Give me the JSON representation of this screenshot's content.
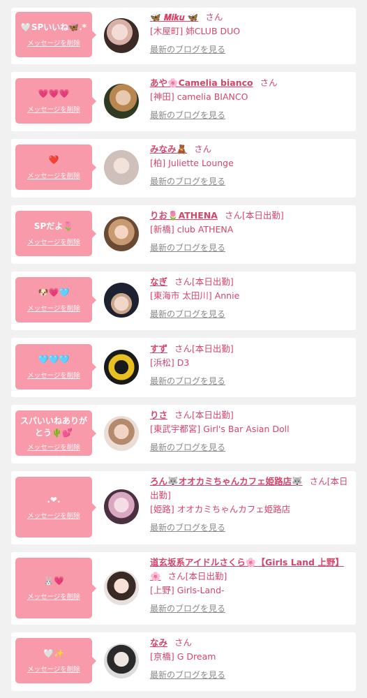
{
  "common": {
    "delete_label": "メッセージを削除",
    "blog_label": "最新のブログを見る",
    "san": "さん"
  },
  "items": [
    {
      "message": "🤍SPいいね🦋.*",
      "name": "🦋 𝑴𝒊𝒌𝒖 🦋",
      "status": "",
      "shop": "[木屋町] 姉CLUB DUO"
    },
    {
      "message": "💗💗💗",
      "name": "あや🌸Camelia bianco",
      "status": "",
      "shop": "[神田] camelia BIANCO"
    },
    {
      "message": "❤️",
      "name": "みなみ🧸",
      "status": "",
      "shop": "[柏] Juliette Lounge"
    },
    {
      "message": "SPだよ🌷",
      "name": "りお🌷ATHENA",
      "status": "[本日出勤]",
      "shop": "[新橋] club ATHENA"
    },
    {
      "message": "🐶💗🩵",
      "name": "なぎ",
      "status": "[本日出勤]",
      "shop": "[東海市 太田川] Annie"
    },
    {
      "message": "🩵🩵🩵",
      "name": "すず",
      "status": "[本日出勤]",
      "shop": "[浜松] D3"
    },
    {
      "message": "スパいいねありがとう🌵💕",
      "name": "りさ",
      "status": "[本日出勤]",
      "shop": "[東武宇都宮] Girl's Bar Asian Doll"
    },
    {
      "message": ".❤︎.",
      "name": "ろん🐺オオカミちゃんカフェ姫路店🐺",
      "status": "[本日出勤]",
      "shop": "[姫路] オオカミちゃんカフェ姫路店"
    },
    {
      "message": "🐰💗",
      "name": "道玄坂系アイドルさくら🌸【Girls Land 上野】🌸",
      "status": "[本日出勤]",
      "shop": "[上野] Girls-Land-"
    },
    {
      "message": "🤍✨",
      "name": "なみ",
      "status": "",
      "shop": "[京橋] G Dream"
    }
  ],
  "colors": {
    "bubble": "#f99aaa",
    "accent": "#d5456b",
    "link_gray": "#8a8a8a",
    "background": "#f1f1f1"
  }
}
